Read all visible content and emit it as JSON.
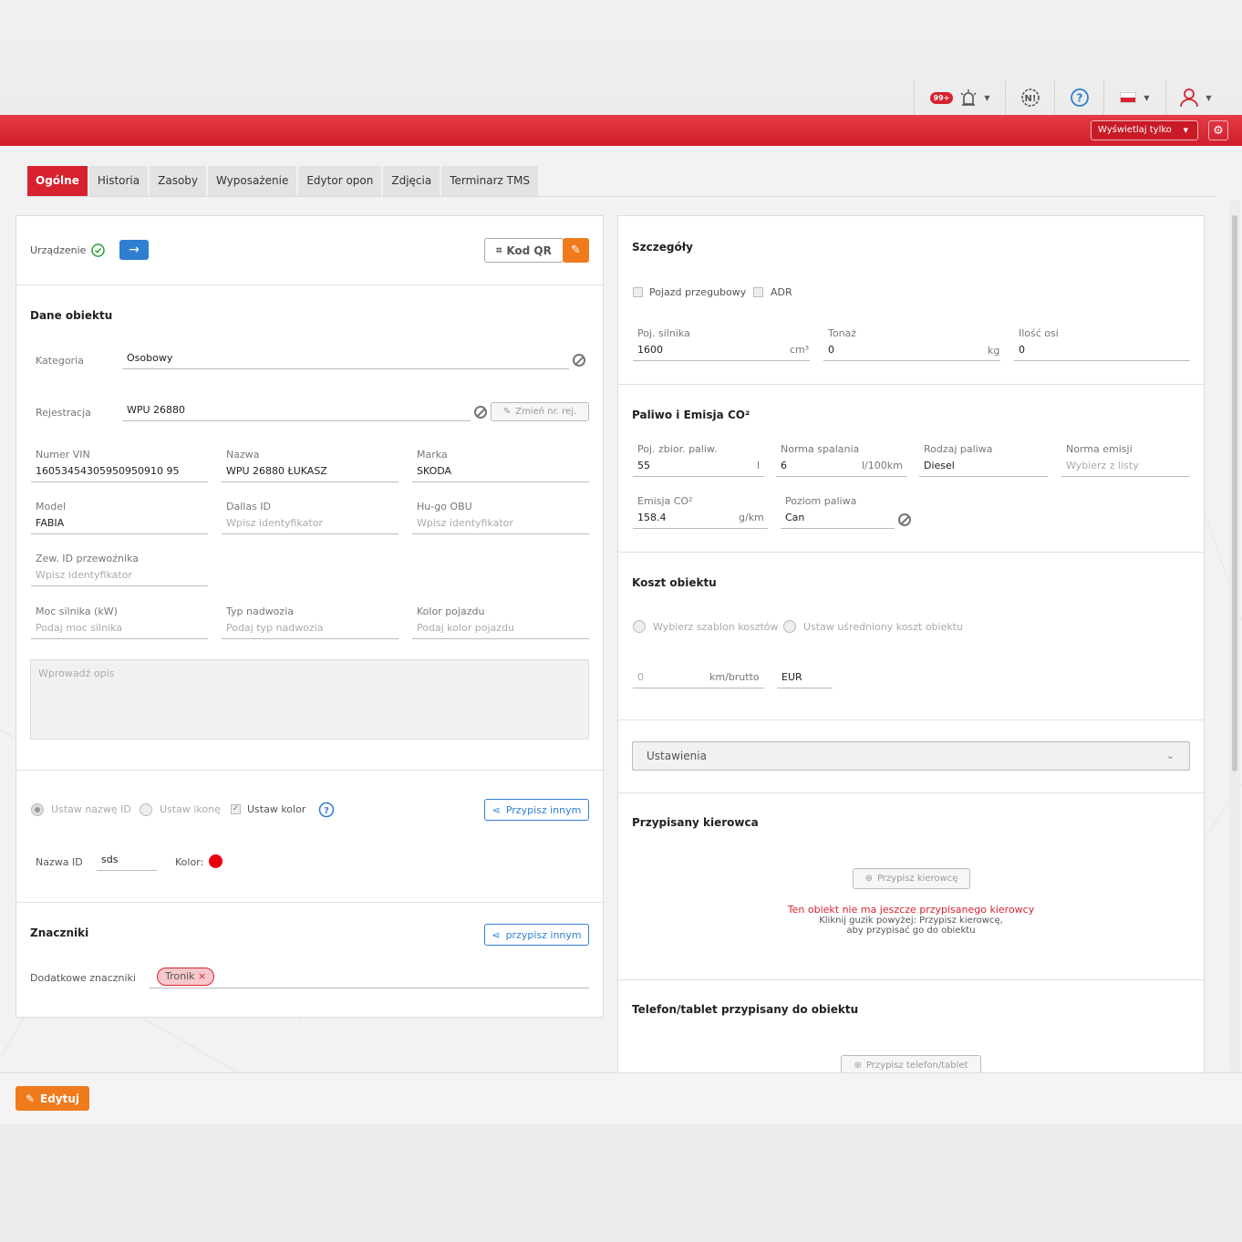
{
  "header": {
    "alerts_badge": "99+",
    "display_only_label": "Wyświetlaj tylko"
  },
  "icons": {
    "alarm": "alarm-icon",
    "notification": "notification-icon",
    "help": "help-icon",
    "flag": "poland-flag-icon",
    "user": "user-icon",
    "settings": "gear-icon"
  },
  "colors": {
    "brand_red": "#d6232f",
    "orange": "#f07b1d",
    "blue": "#2f7fd1",
    "vehicle_color": "#e8000d"
  },
  "tabs": [
    "Ogólne",
    "Historia",
    "Zasoby",
    "Wyposażenie",
    "Edytor opon",
    "Zdjęcia",
    "Terminarz TMS"
  ],
  "left": {
    "device_label": "Urządzenie",
    "qr_label": "Kod QR",
    "section_title": "Dane obiektu",
    "category_label": "Kategoria",
    "category_value": "Osobowy",
    "registration_label": "Rejestracja",
    "registration_value": "WPU 26880",
    "change_reg_label": "Zmień nr. rej.",
    "vin_label": "Numer VIN",
    "vin_value": "16053454305950950910 95",
    "name_label": "Nazwa",
    "name_value": "WPU 26880 ŁUKASZ",
    "brand_label": "Marka",
    "brand_value": "SKODA",
    "model_label": "Model",
    "model_value": "FABIA",
    "dallas_label": "Dallas ID",
    "dallas_placeholder": "Wpisz identyfikator",
    "hugo_label": "Hu-go OBU",
    "hugo_placeholder": "Wpisz identyfikator",
    "ext_id_label": "Zew. ID przewoźnika",
    "ext_id_placeholder": "Wpisz identyfikator",
    "power_label": "Moc silnika (kW)",
    "power_placeholder": "Podaj moc silnika",
    "body_label": "Typ nadwozia",
    "body_placeholder": "Podaj typ nadwozia",
    "color_label": "Kolor pojazdu",
    "color_placeholder": "Podaj kolor pojazdu",
    "description_placeholder": "Wprowadź opis",
    "set_name_id": "Ustaw nazwę ID",
    "set_icon": "Ustaw ikonę",
    "set_color": "Ustaw kolor",
    "assign_other": "Przypisz innym",
    "name_id_label": "Nazwa ID",
    "name_id_value": "sds",
    "color_field_label": "Kolor:",
    "tags_title": "Znaczniki",
    "tags_assign": "przypisz innym",
    "extra_tags_label": "Dodatkowe znaczniki",
    "tag": "Tronik"
  },
  "right": {
    "details_title": "Szczegóły",
    "articulated_label": "Pojazd przegubowy",
    "adr_label": "ADR",
    "engine_label": "Poj. silnika",
    "engine_value": "1600",
    "engine_unit": "cm³",
    "tonnage_label": "Tonaż",
    "tonnage_value": "0",
    "tonnage_unit": "kg",
    "axles_label": "Ilość osi",
    "axles_value": "0",
    "fuel_title": "Paliwo i Emisja CO²",
    "tank_label": "Poj. zbior. paliw.",
    "tank_value": "55",
    "tank_unit": "l",
    "consumption_label": "Norma spalania",
    "consumption_value": "6",
    "consumption_unit": "l/100km",
    "fuel_type_label": "Rodzaj paliwa",
    "fuel_type_value": "Diesel",
    "emission_norm_label": "Norma emisji",
    "emission_norm_placeholder": "Wybierz z listy",
    "co2_label": "Emisja CO²",
    "co2_value": "158.4",
    "co2_unit": "g/km",
    "fuel_level_label": "Poziom paliwa",
    "fuel_level_value": "Can",
    "cost_title": "Koszt obiektu",
    "cost_template": "Wybierz szablon kosztów",
    "cost_average": "Ustaw uśredniony koszt obiektu",
    "cost_value": "0",
    "cost_unit": "km/brutto",
    "currency": "EUR",
    "settings_label": "Ustawienia",
    "driver_title": "Przypisany kierowca",
    "assign_driver": "Przypisz kierowcę",
    "no_driver": "Ten obiekt nie ma jeszcze przypisanego kierowcy",
    "no_driver_hint1": "Kliknij guzik powyżej: Przypisz kierowcę,",
    "no_driver_hint2": "aby przypisać go do obiektu",
    "phone_title": "Telefon/tablet przypisany do obiektu",
    "assign_phone": "Przypisz telefon/tablet"
  },
  "footer": {
    "edit_label": "Edytuj"
  }
}
